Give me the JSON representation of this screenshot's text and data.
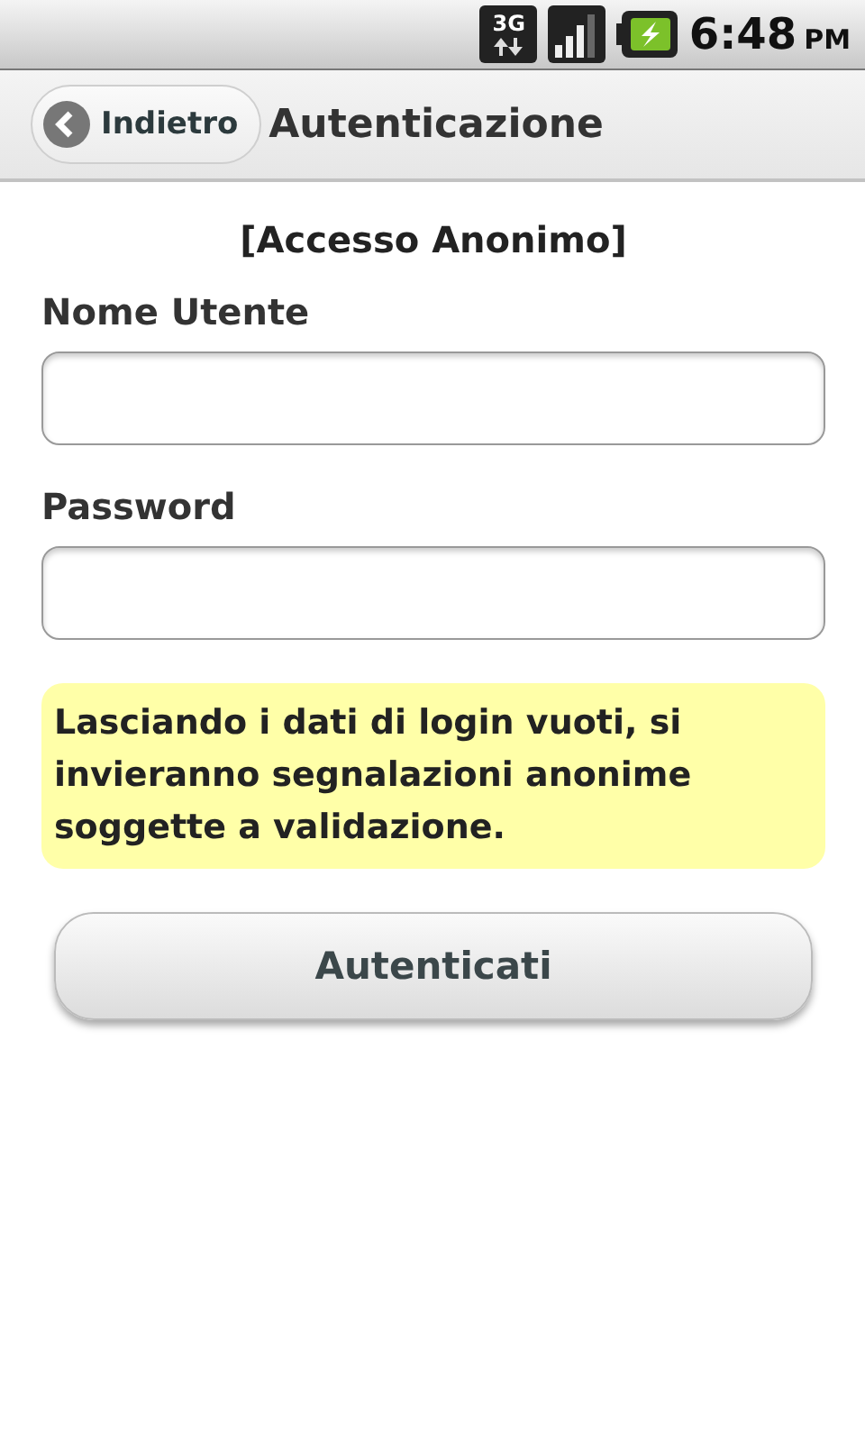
{
  "status_bar": {
    "network": "3G",
    "time": "6:48",
    "ampm": "PM"
  },
  "header": {
    "back": "Indietro",
    "title": "Autenticazione"
  },
  "subtitle": "[Accesso Anonimo]",
  "fields": [
    {
      "label": "Nome Utente"
    },
    {
      "label": "Password"
    }
  ],
  "notice": "Lasciando i dati di login vuoti, si invieranno segnalazioni anonime soggette a validazione.",
  "button": "Autenticati"
}
